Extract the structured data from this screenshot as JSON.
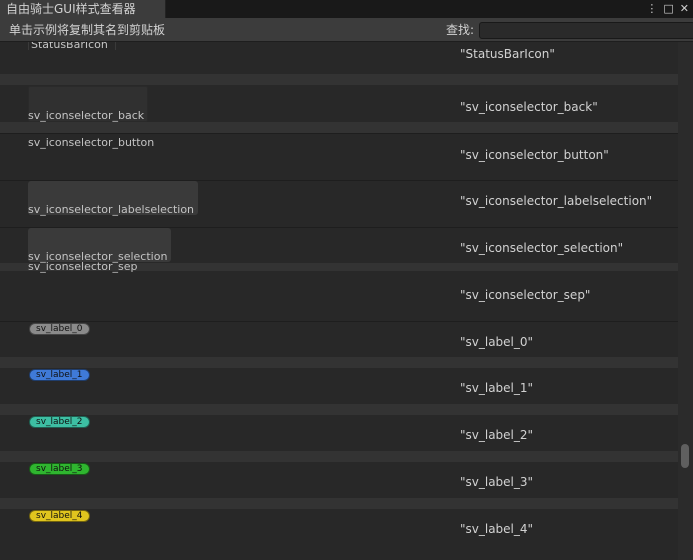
{
  "window": {
    "tab_title": "自由骑士GUI样式查看器",
    "icons": [
      "more-vert-icon",
      "maximize-icon",
      "close-icon"
    ]
  },
  "toolbar": {
    "hint": "单击示例将复制其名到剪贴板",
    "search_label": "查找:",
    "search_value": "",
    "search_placeholder": ""
  },
  "rows": [
    {
      "name": "StatusBarIcon",
      "quoted": "\"StatusBarIcon\""
    },
    {
      "name": "sv_iconselector_back",
      "quoted": "\"sv_iconselector_back\""
    },
    {
      "name": "sv_iconselector_button",
      "quoted": "\"sv_iconselector_button\""
    },
    {
      "name": "sv_iconselector_labelselection",
      "quoted": "\"sv_iconselector_labelselection\""
    },
    {
      "name": "sv_iconselector_selection",
      "quoted": "\"sv_iconselector_selection\""
    },
    {
      "name": "sv_iconselector_sep",
      "quoted": "\"sv_iconselector_sep\""
    },
    {
      "name": "sv_label_0",
      "quoted": "\"sv_label_0\"",
      "color": "#8a8a8a"
    },
    {
      "name": "sv_label_1",
      "quoted": "\"sv_label_1\"",
      "color": "#3f7ad8"
    },
    {
      "name": "sv_label_2",
      "quoted": "\"sv_label_2\"",
      "color": "#3dbfa3"
    },
    {
      "name": "sv_label_3",
      "quoted": "\"sv_label_3\"",
      "color": "#2fb52f"
    },
    {
      "name": "sv_label_4",
      "quoted": "\"sv_label_4\"",
      "color": "#e0c51e"
    }
  ],
  "scrollbar": {
    "position": 0.83
  }
}
